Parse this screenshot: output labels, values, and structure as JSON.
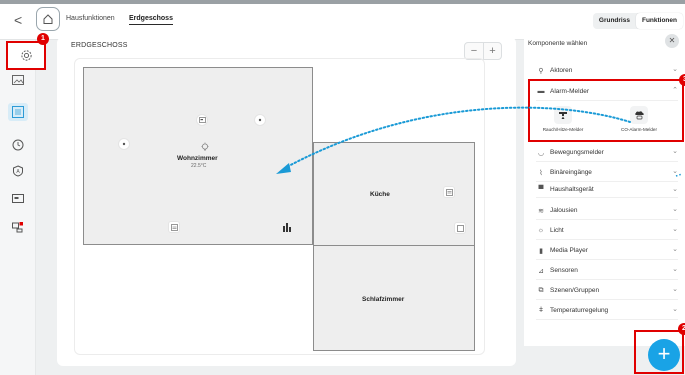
{
  "header": {
    "back_label": "<",
    "tabs": [
      {
        "label": "Hausfunktionen"
      },
      {
        "label": "Erdgeschoss"
      }
    ],
    "views": [
      {
        "label": "Grundriss"
      },
      {
        "label": "Funktionen"
      }
    ]
  },
  "sidebar": {
    "items": [
      {
        "icon": "gear-icon"
      },
      {
        "icon": "image-icon"
      },
      {
        "icon": "floorplan-icon"
      },
      {
        "icon": "timer-icon"
      },
      {
        "icon": "shield-icon"
      },
      {
        "icon": "monitor-icon"
      },
      {
        "icon": "devices-icon"
      }
    ]
  },
  "plan": {
    "floor_title": "ERDGESCHOSS",
    "zoom_out": "−",
    "zoom_in": "+",
    "rooms": [
      {
        "name": "Wohnzimmer",
        "temperature": "22.5°C"
      },
      {
        "name": "Küche"
      },
      {
        "name": "Schlafzimmer"
      }
    ]
  },
  "components": {
    "title": "Komponente wählen",
    "close": "✕",
    "alarm_devices": [
      {
        "label": "Rauch/Hitze-Melder"
      },
      {
        "label": "CO-Alarm-Melder"
      }
    ],
    "categories": [
      {
        "label": "Aktoren",
        "chev": "⌄"
      },
      {
        "label": "Alarm-Melder",
        "chev": "⌃"
      },
      {
        "label": "Bewegungsmelder",
        "chev": "⌄"
      },
      {
        "label": "Binäreingänge",
        "chev": "⌄"
      },
      {
        "label": "Haushaltsgerät",
        "chev": "⌄"
      },
      {
        "label": "Jalousien",
        "chev": "⌄"
      },
      {
        "label": "Licht",
        "chev": "⌄"
      },
      {
        "label": "Media Player",
        "chev": "⌄"
      },
      {
        "label": "Sensoren",
        "chev": "⌄"
      },
      {
        "label": "Szenen/Gruppen",
        "chev": "⌄"
      },
      {
        "label": "Temperaturregelung",
        "chev": "⌄"
      }
    ]
  },
  "annotations": {
    "badge_1": "1",
    "badge_2": "2",
    "badge_3": "3"
  },
  "fab": {
    "label": "+"
  },
  "colors": {
    "accent": "#19a3e6",
    "highlight_red": "#e00000",
    "arrow": "#1a9ad6",
    "room_fill": "#eeeeee"
  }
}
